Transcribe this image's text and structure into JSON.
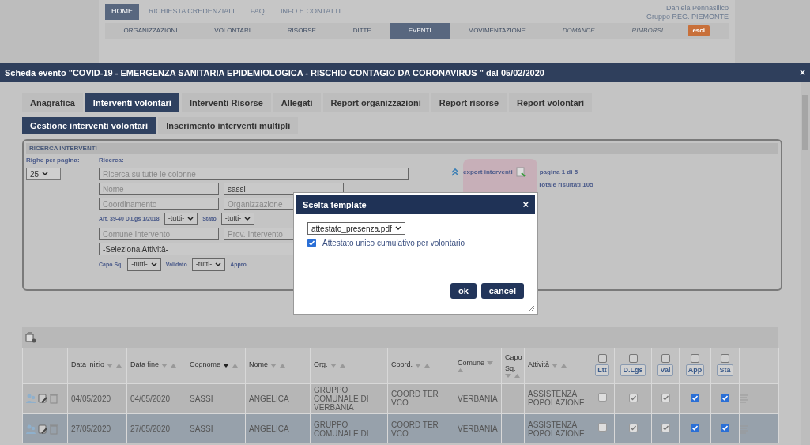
{
  "top_nav": [
    {
      "label": "HOME",
      "selected": true
    },
    {
      "label": "RICHIESTA CREDENZIALI",
      "selected": false
    },
    {
      "label": "FAQ",
      "selected": false
    },
    {
      "label": "INFO E CONTATTI",
      "selected": false
    }
  ],
  "user": {
    "name": "Daniela Pennasilico",
    "group": "Gruppo REG. PIEMONTE"
  },
  "main_nav": [
    {
      "label": "ORGANIZZAZIONI",
      "selected": false,
      "disabled": false
    },
    {
      "label": "VOLONTARI",
      "selected": false,
      "disabled": false
    },
    {
      "label": "RISORSE",
      "selected": false,
      "disabled": false
    },
    {
      "label": "DITTE",
      "selected": false,
      "disabled": false
    },
    {
      "label": "EVENTI",
      "selected": true,
      "disabled": false
    },
    {
      "label": "MOVIMENTAZIONE",
      "selected": false,
      "disabled": false
    },
    {
      "label": "DOMANDE",
      "selected": false,
      "disabled": true
    },
    {
      "label": "RIMBORSI",
      "selected": false,
      "disabled": true
    }
  ],
  "logout_button": "esci",
  "window": {
    "title": "Scheda evento \"COVID-19 - EMERGENZA SANITARIA EPIDEMIOLOGICA - RISCHIO CONTAGIO DA CORONAVIRUS \" dal 05/02/2020",
    "close": "×"
  },
  "tabs": [
    {
      "label": "Anagrafica",
      "selected": false
    },
    {
      "label": "Interventi volontari",
      "selected": true
    },
    {
      "label": "Interventi Risorse",
      "selected": false
    },
    {
      "label": "Allegati",
      "selected": false
    },
    {
      "label": "Report organizzazioni",
      "selected": false
    },
    {
      "label": "Report risorse",
      "selected": false
    },
    {
      "label": "Report volontari",
      "selected": false
    }
  ],
  "subtabs": [
    {
      "label": "Gestione interventi volontari",
      "selected": true
    },
    {
      "label": "Inserimento interventi multipli",
      "selected": false
    }
  ],
  "search": {
    "legend": "RICERCA INTERVENTI",
    "rows_label": "Righe per pagina:",
    "rows_value": "25",
    "search_label": "Ricerca:",
    "search_placeholder": "Ricerca su tutte le colonne",
    "fields": [
      {
        "placeholder": "Nome"
      },
      {
        "value": "sassi"
      },
      {
        "placeholder": "Coordinamento"
      },
      {
        "placeholder": "Organizzazione"
      }
    ],
    "art_label": "Art. 39-40 D.Lgs 1/2018",
    "art_value": "-tutti-",
    "stato_label": "Stato",
    "stato_value": "-tutti-",
    "fields2": [
      {
        "placeholder": "Comune Intervento"
      },
      {
        "placeholder": "Prov. Intervento"
      }
    ],
    "activity": "-Seleziona Attività-",
    "capo_label": "Capo Sq.",
    "capo_value": "-tutti-",
    "validato_label": "Validato",
    "validato_value": "-tutti-",
    "appro_label": "Appro",
    "export_label": "export interventi",
    "page_info": "pagina 1 di 5",
    "total": "Totale risultati 105"
  },
  "dialog": {
    "title": "Scelta template",
    "close": "×",
    "template": "attestato_presenza.pdf",
    "cumulative_label": "Attestato unico cumulativo per volontario",
    "cumulative_checked": true,
    "ok": "ok",
    "cancel": "cancel"
  },
  "table": {
    "columns": [
      {
        "label": "Data inizio",
        "sort_active": false
      },
      {
        "label": "Data fine",
        "sort_active": false
      },
      {
        "label": "Cognome",
        "sort_active": true
      },
      {
        "label": "Nome",
        "sort_active": false
      },
      {
        "label": "Org.",
        "sort_active": false
      },
      {
        "label": "Coord.",
        "sort_active": false
      },
      {
        "label": "Comune",
        "sort_active": false
      },
      {
        "label": "Capo Sq.",
        "sort_active": false
      },
      {
        "label": "Attività",
        "sort_active": false
      }
    ],
    "check_columns": [
      {
        "label": "Ltt",
        "checked": false
      },
      {
        "label": "D.Lgs",
        "checked": false
      },
      {
        "label": "Val",
        "checked": false
      },
      {
        "label": "App",
        "checked": false
      },
      {
        "label": "Sta",
        "checked": false
      }
    ],
    "rows": [
      {
        "selected": false,
        "cells": [
          "04/05/2020",
          "04/05/2020",
          "SASSI",
          "ANGELICA",
          "GRUPPO COMUNALE DI VERBANIA",
          "COORD TER VCO",
          "VERBANIA",
          "",
          "ASSISTENZA POPOLAZIONE"
        ],
        "checks": [
          {
            "checked": false,
            "disabled": true
          },
          {
            "checked": true,
            "disabled": true
          },
          {
            "checked": true,
            "disabled": true
          },
          {
            "checked": true,
            "disabled": false
          },
          {
            "checked": true,
            "disabled": false
          }
        ]
      },
      {
        "selected": true,
        "cells": [
          "27/05/2020",
          "27/05/2020",
          "SASSI",
          "ANGELICA",
          "GRUPPO COMUNALE DI",
          "COORD TER VCO",
          "VERBANIA",
          "",
          "ASSISTENZA POPOLAZIONE"
        ],
        "checks": [
          {
            "checked": false,
            "disabled": true
          },
          {
            "checked": true,
            "disabled": true
          },
          {
            "checked": true,
            "disabled": true
          },
          {
            "checked": true,
            "disabled": false
          },
          {
            "checked": true,
            "disabled": false
          }
        ]
      }
    ]
  }
}
